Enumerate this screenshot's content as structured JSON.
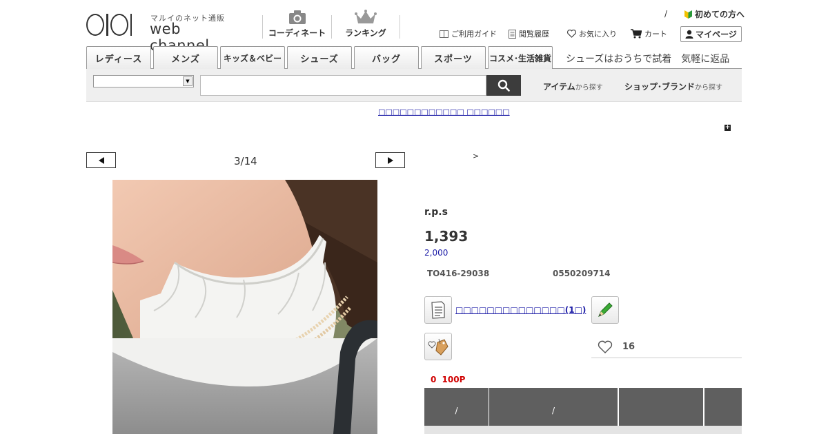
{
  "header": {
    "logo_sub": "マルイのネット通販",
    "logo_main": "web channel",
    "nav": [
      {
        "label": "コーディネート",
        "icon": "camera-icon"
      },
      {
        "label": "ランキング",
        "icon": "crown-icon"
      }
    ],
    "slash": "/",
    "first_time": "初めての方へ",
    "util": [
      {
        "label": "ご利用ガイド",
        "icon": "guide-icon"
      },
      {
        "label": "閲覧履歴",
        "icon": "history-icon"
      },
      {
        "label": "お気に入り",
        "icon": "heart-icon"
      },
      {
        "label": "カート",
        "icon": "cart-icon"
      }
    ],
    "mypage": "マイページ"
  },
  "categories": [
    "レディース",
    "メンズ",
    "キッズ＆ベビー",
    "シューズ",
    "バッグ",
    "スポーツ",
    "コスメ･生活雑貨"
  ],
  "promo": "シューズはおうちで試着　気軽に返品",
  "search": {
    "placeholder": "",
    "item_link": "アイテム",
    "item_suffix": "から探す",
    "shop_link": "ショップ･ブランド",
    "shop_suffix": "から探す"
  },
  "notice": "□□□□□□□□□□□□ □□□□□□",
  "gallery": {
    "counter": "3/14"
  },
  "product": {
    "crumb": ">",
    "brand": "r.p.s",
    "price": "1,393",
    "original_price": "2,000",
    "code1": "TO416-29038",
    "code2": "0550209714",
    "review_link": "□□□□□□□□□□□□□□(1□)",
    "fav_count": "16",
    "points": "0 100P"
  },
  "table": {
    "headers": [
      "/",
      "/",
      "",
      ""
    ]
  },
  "colors": {
    "accent_dark": "#3c3c3c",
    "link_blue": "#1a1aa6",
    "point_red": "#d00000",
    "table_header": "#5f5f5f"
  }
}
